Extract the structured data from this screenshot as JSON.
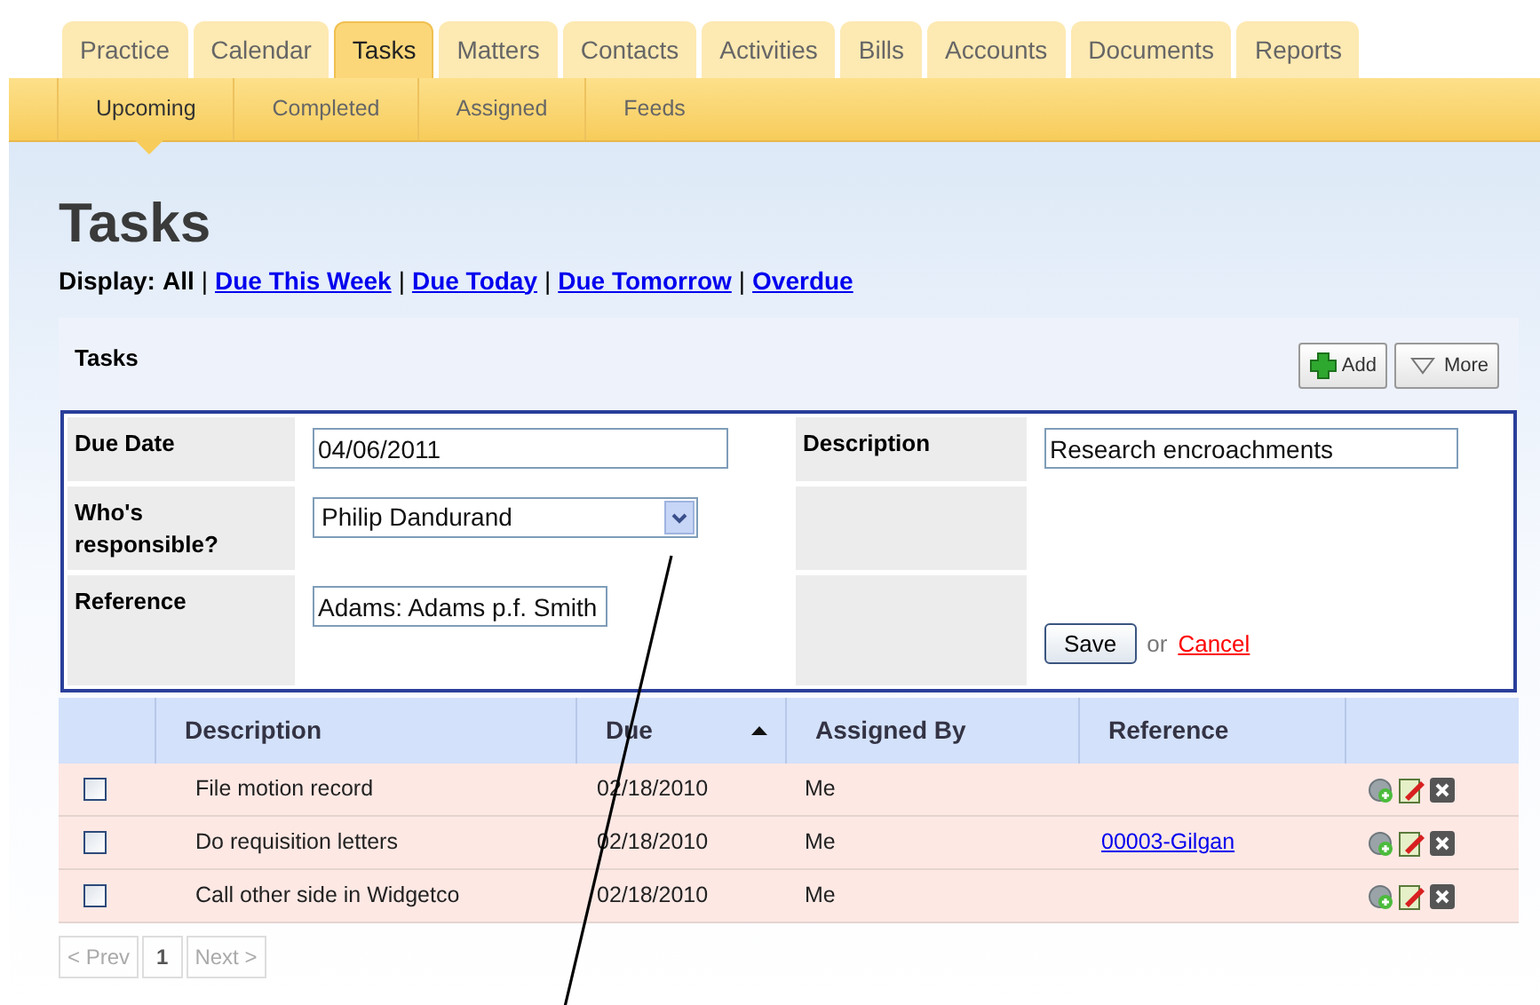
{
  "tabs": [
    {
      "label": "Practice",
      "selected": false
    },
    {
      "label": "Calendar",
      "selected": false
    },
    {
      "label": "Tasks",
      "selected": true
    },
    {
      "label": "Matters",
      "selected": false
    },
    {
      "label": "Contacts",
      "selected": false
    },
    {
      "label": "Activities",
      "selected": false
    },
    {
      "label": "Bills",
      "selected": false
    },
    {
      "label": "Accounts",
      "selected": false
    },
    {
      "label": "Documents",
      "selected": false
    },
    {
      "label": "Reports",
      "selected": false
    }
  ],
  "subtabs": [
    {
      "label": "Upcoming",
      "selected": true
    },
    {
      "label": "Completed",
      "selected": false
    },
    {
      "label": "Assigned",
      "selected": false
    },
    {
      "label": "Feeds",
      "selected": false
    }
  ],
  "page_title": "Tasks",
  "display_filter": {
    "label": "Display:",
    "separator": "|",
    "options": [
      {
        "label": "All",
        "selected": true
      },
      {
        "label": "Due This Week",
        "selected": false
      },
      {
        "label": "Due Today",
        "selected": false
      },
      {
        "label": "Due Tomorrow",
        "selected": false
      },
      {
        "label": "Overdue",
        "selected": false
      }
    ]
  },
  "panel": {
    "title": "Tasks",
    "buttons": [
      {
        "label": "Add",
        "kind": "add"
      },
      {
        "label": "More",
        "kind": "more"
      }
    ]
  },
  "form": {
    "due_date": {
      "label": "Due Date",
      "value": "04/06/2011"
    },
    "description": {
      "label": "Description",
      "value": "Research encroachments"
    },
    "responsible": {
      "label": "Who's responsible?",
      "value": "Philip Dandurand"
    },
    "reference": {
      "label": "Reference",
      "value": "Adams: Adams p.f. Smith"
    },
    "save": "Save",
    "or": "or",
    "cancel": "Cancel"
  },
  "table": {
    "columns": [
      {
        "label": "Description"
      },
      {
        "label": "Due",
        "sorted": true
      },
      {
        "label": "Assigned By"
      },
      {
        "label": "Reference"
      }
    ],
    "rows": [
      {
        "checked": false,
        "description": "File motion record",
        "due": "02/18/2010",
        "assigned_by": "Me"
      },
      {
        "checked": false,
        "description": "Do requisition letters",
        "due": "02/18/2010",
        "assigned_by": "Me",
        "reference": "00003-Gilgan"
      },
      {
        "checked": false,
        "description": "Call other side in Widgetco",
        "due": "02/18/2010",
        "assigned_by": "Me"
      }
    ]
  },
  "pagination": {
    "prev": "< Prev",
    "pages": [
      {
        "label": "1",
        "selected": true
      }
    ],
    "next": "Next >"
  }
}
